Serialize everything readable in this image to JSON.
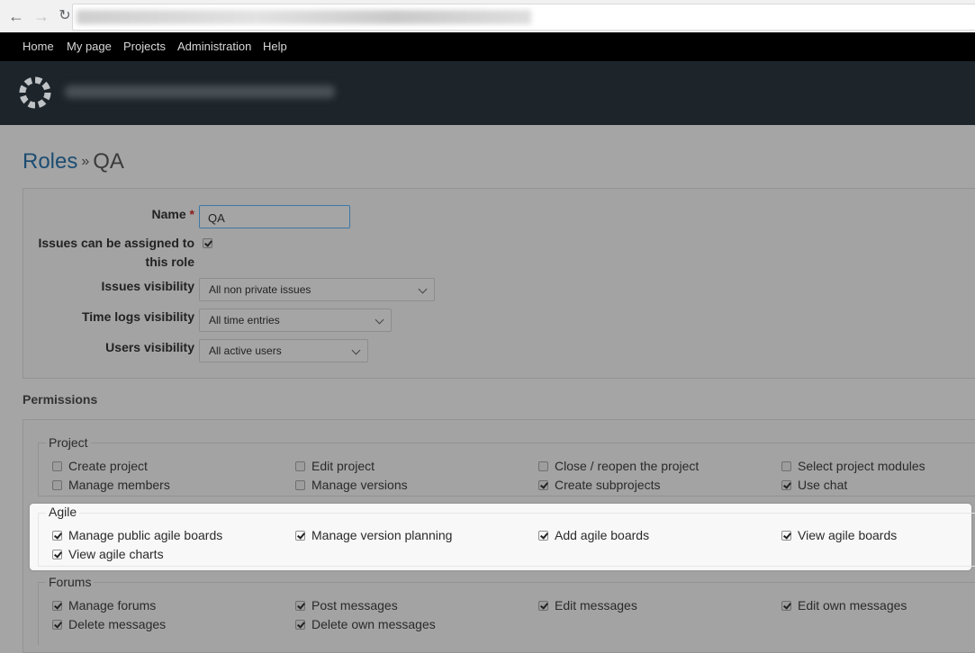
{
  "menu": [
    "Home",
    "My page",
    "Projects",
    "Administration",
    "Help"
  ],
  "breadcrumb": {
    "parent": "Roles",
    "separator": "»",
    "current": "QA"
  },
  "form": {
    "name_label": "Name",
    "required_mark": "*",
    "name_value": "QA",
    "assignable_label_line1": "Issues can be assigned to",
    "assignable_label_line2": "this role",
    "assignable_checked": true,
    "issues_visibility_label": "Issues visibility",
    "issues_visibility_value": "All non private issues",
    "timelogs_visibility_label": "Time logs visibility",
    "timelogs_visibility_value": "All time entries",
    "users_visibility_label": "Users visibility",
    "users_visibility_value": "All active users"
  },
  "permissions": {
    "heading": "Permissions",
    "project": {
      "legend": "Project",
      "items": [
        {
          "label": "Create project",
          "checked": false
        },
        {
          "label": "Edit project",
          "checked": false
        },
        {
          "label": "Close / reopen the project",
          "checked": false
        },
        {
          "label": "Select project modules",
          "checked": false
        },
        {
          "label": "Manage members",
          "checked": false
        },
        {
          "label": "Manage versions",
          "checked": false
        },
        {
          "label": "Create subprojects",
          "checked": true
        },
        {
          "label": "Use chat",
          "checked": true
        }
      ]
    },
    "agile": {
      "legend": "Agile",
      "items": [
        {
          "label": "Manage public agile boards",
          "checked": true
        },
        {
          "label": "Manage version planning",
          "checked": true
        },
        {
          "label": "Add agile boards",
          "checked": true
        },
        {
          "label": "View agile boards",
          "checked": true
        },
        {
          "label": "View agile charts",
          "checked": true
        }
      ]
    },
    "forums": {
      "legend": "Forums",
      "items": [
        {
          "label": "Manage forums",
          "checked": true
        },
        {
          "label": "Post messages",
          "checked": true
        },
        {
          "label": "Edit messages",
          "checked": true
        },
        {
          "label": "Edit own messages",
          "checked": true
        },
        {
          "label": "Delete messages",
          "checked": true
        },
        {
          "label": "Delete own messages",
          "checked": true
        }
      ]
    }
  }
}
